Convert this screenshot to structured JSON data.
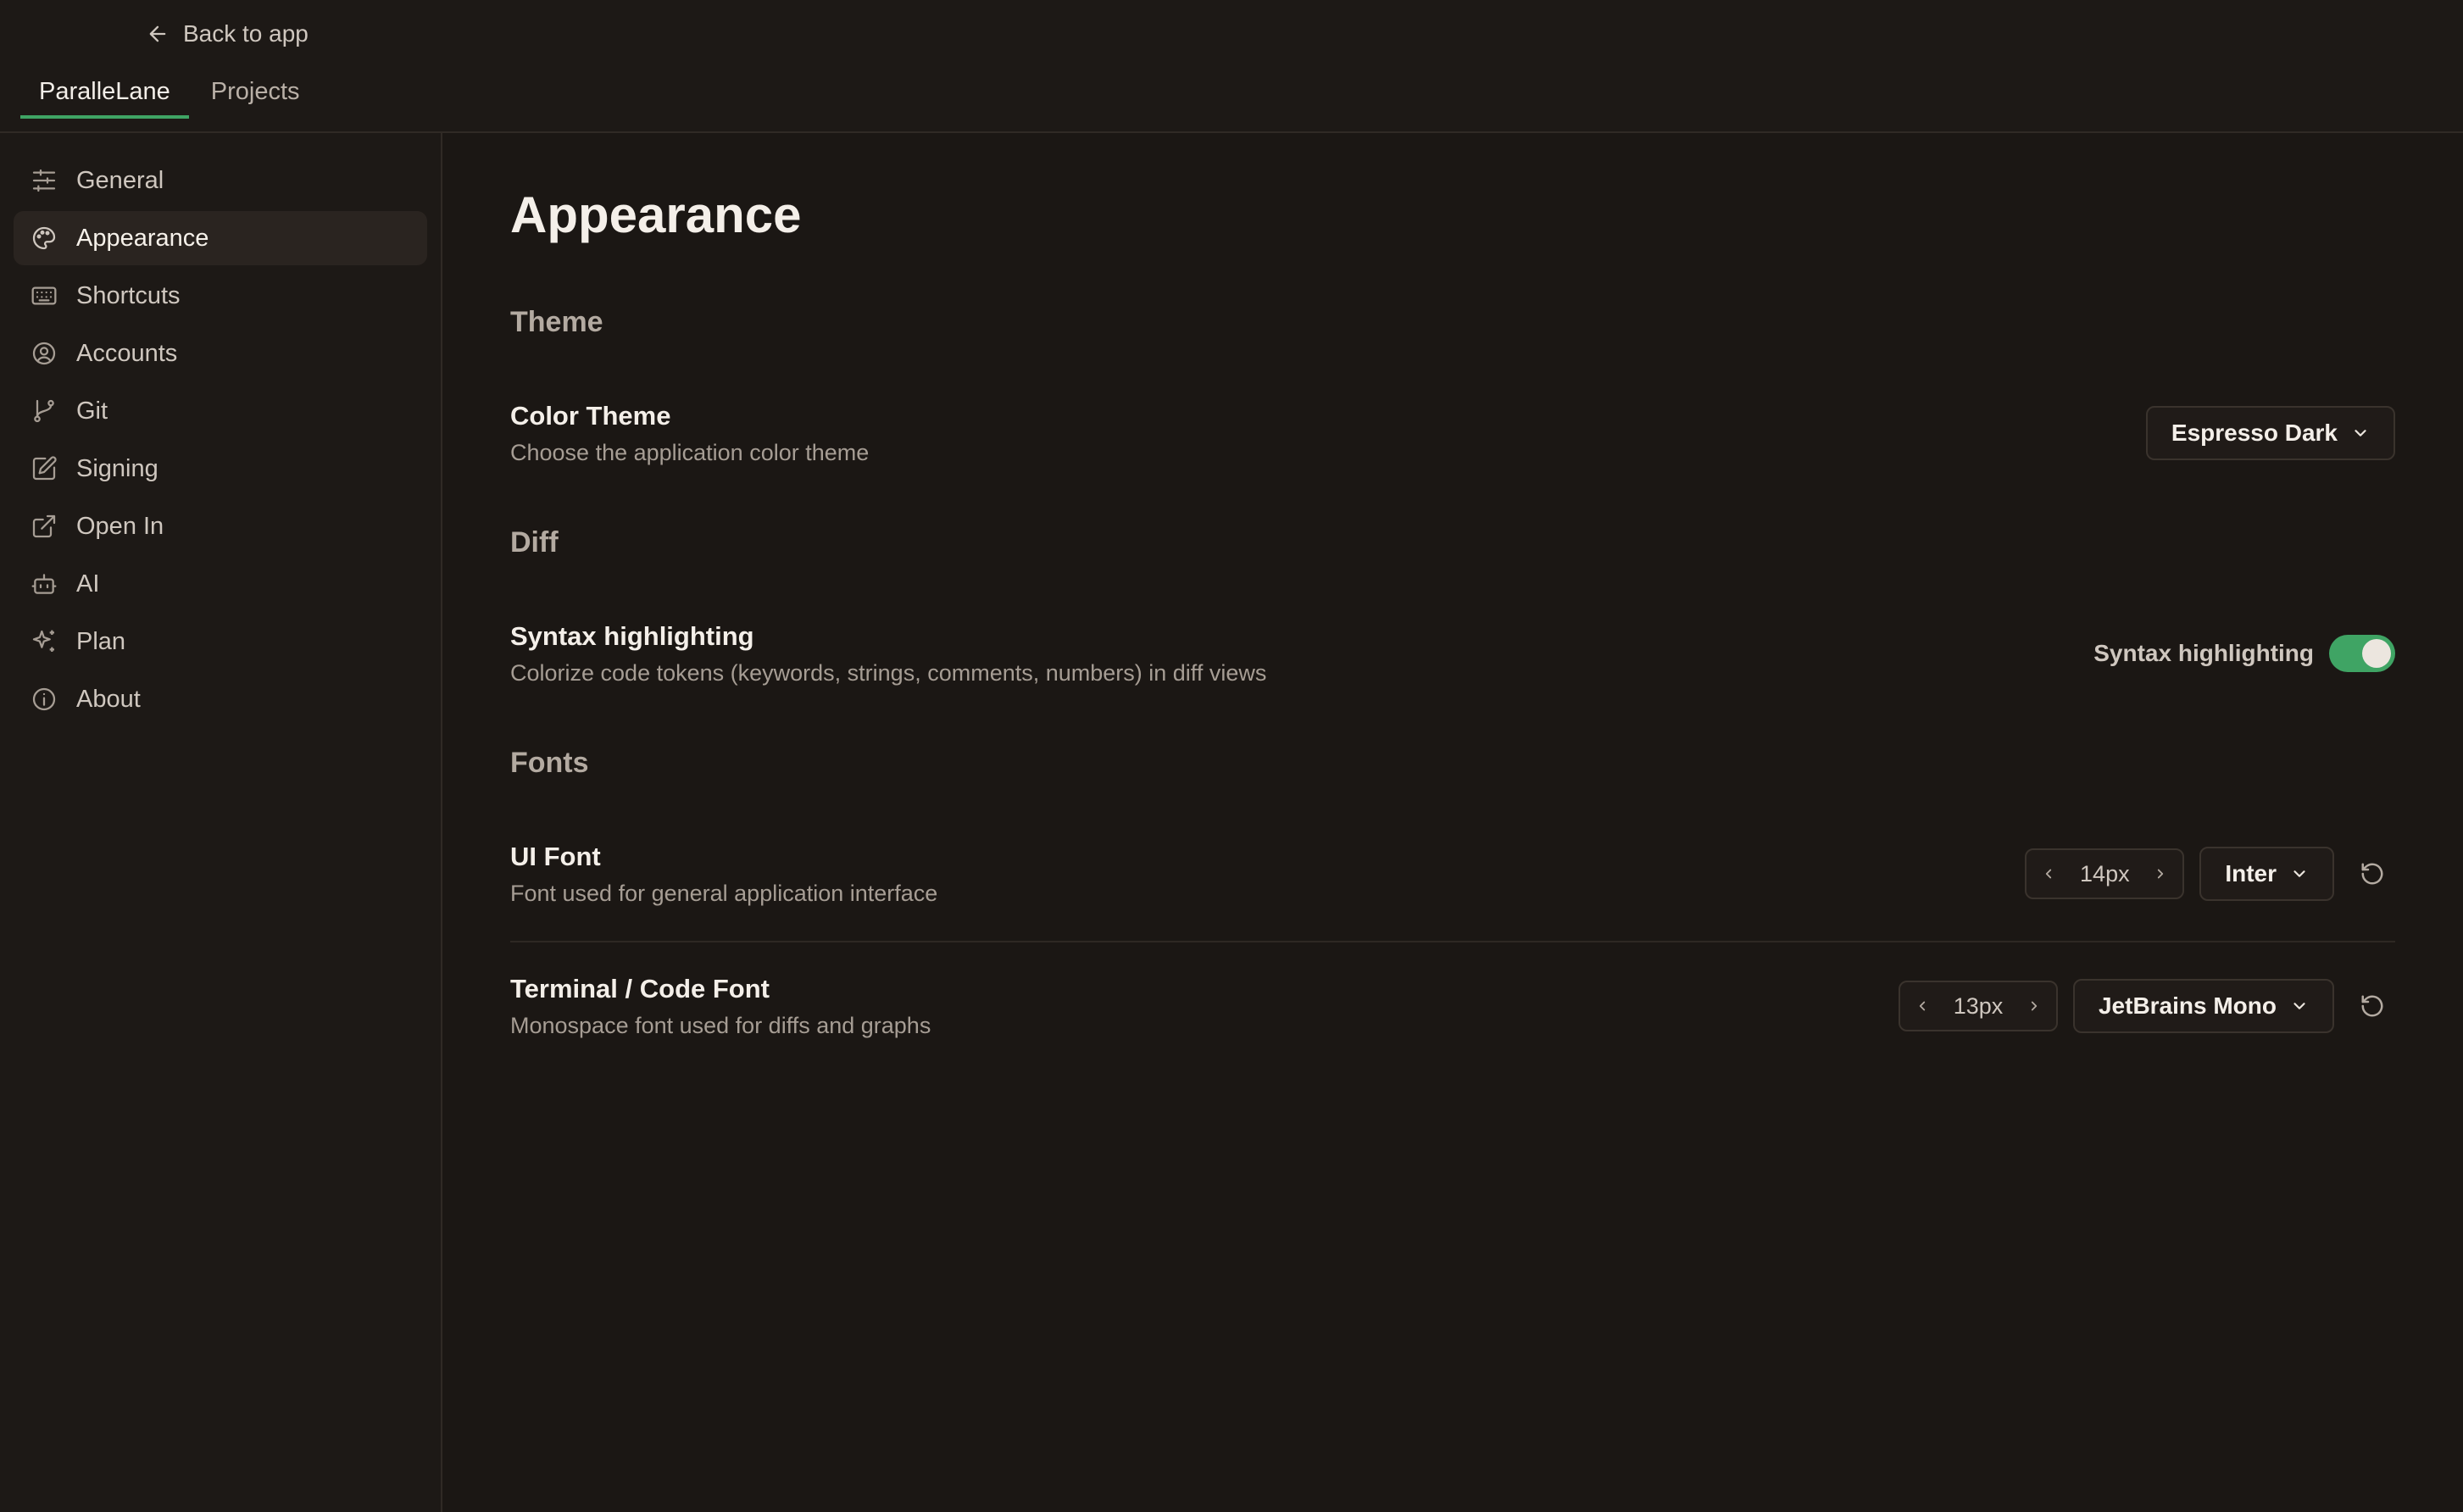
{
  "header": {
    "back_label": "Back to app",
    "tabs": [
      {
        "label": "ParalleLane",
        "active": true
      },
      {
        "label": "Projects",
        "active": false
      }
    ]
  },
  "sidebar": {
    "items": [
      {
        "label": "General",
        "icon": "sliders-icon"
      },
      {
        "label": "Appearance",
        "icon": "palette-icon",
        "active": true
      },
      {
        "label": "Shortcuts",
        "icon": "keyboard-icon"
      },
      {
        "label": "Accounts",
        "icon": "user-circle-icon"
      },
      {
        "label": "Git",
        "icon": "git-branch-icon"
      },
      {
        "label": "Signing",
        "icon": "edit-icon"
      },
      {
        "label": "Open In",
        "icon": "external-link-icon"
      },
      {
        "label": "AI",
        "icon": "bot-icon"
      },
      {
        "label": "Plan",
        "icon": "sparkle-icon"
      },
      {
        "label": "About",
        "icon": "info-icon"
      }
    ]
  },
  "main": {
    "title": "Appearance",
    "sections": {
      "theme": "Theme",
      "diff": "Diff",
      "fonts": "Fonts"
    },
    "color_theme": {
      "title": "Color Theme",
      "description": "Choose the application color theme",
      "value": "Espresso Dark"
    },
    "syntax": {
      "title": "Syntax highlighting",
      "description": "Colorize code tokens (keywords, strings, comments, numbers) in diff views",
      "toggle_label": "Syntax highlighting",
      "enabled": true
    },
    "ui_font": {
      "title": "UI Font",
      "description": "Font used for general application interface",
      "size": "14px",
      "family": "Inter"
    },
    "code_font": {
      "title": "Terminal / Code Font",
      "description": "Monospace font used for diffs and graphs",
      "size": "13px",
      "family": "JetBrains Mono"
    }
  },
  "colors": {
    "background": "#1b1714",
    "accent": "#3fa464",
    "text": "#f4efe9"
  }
}
